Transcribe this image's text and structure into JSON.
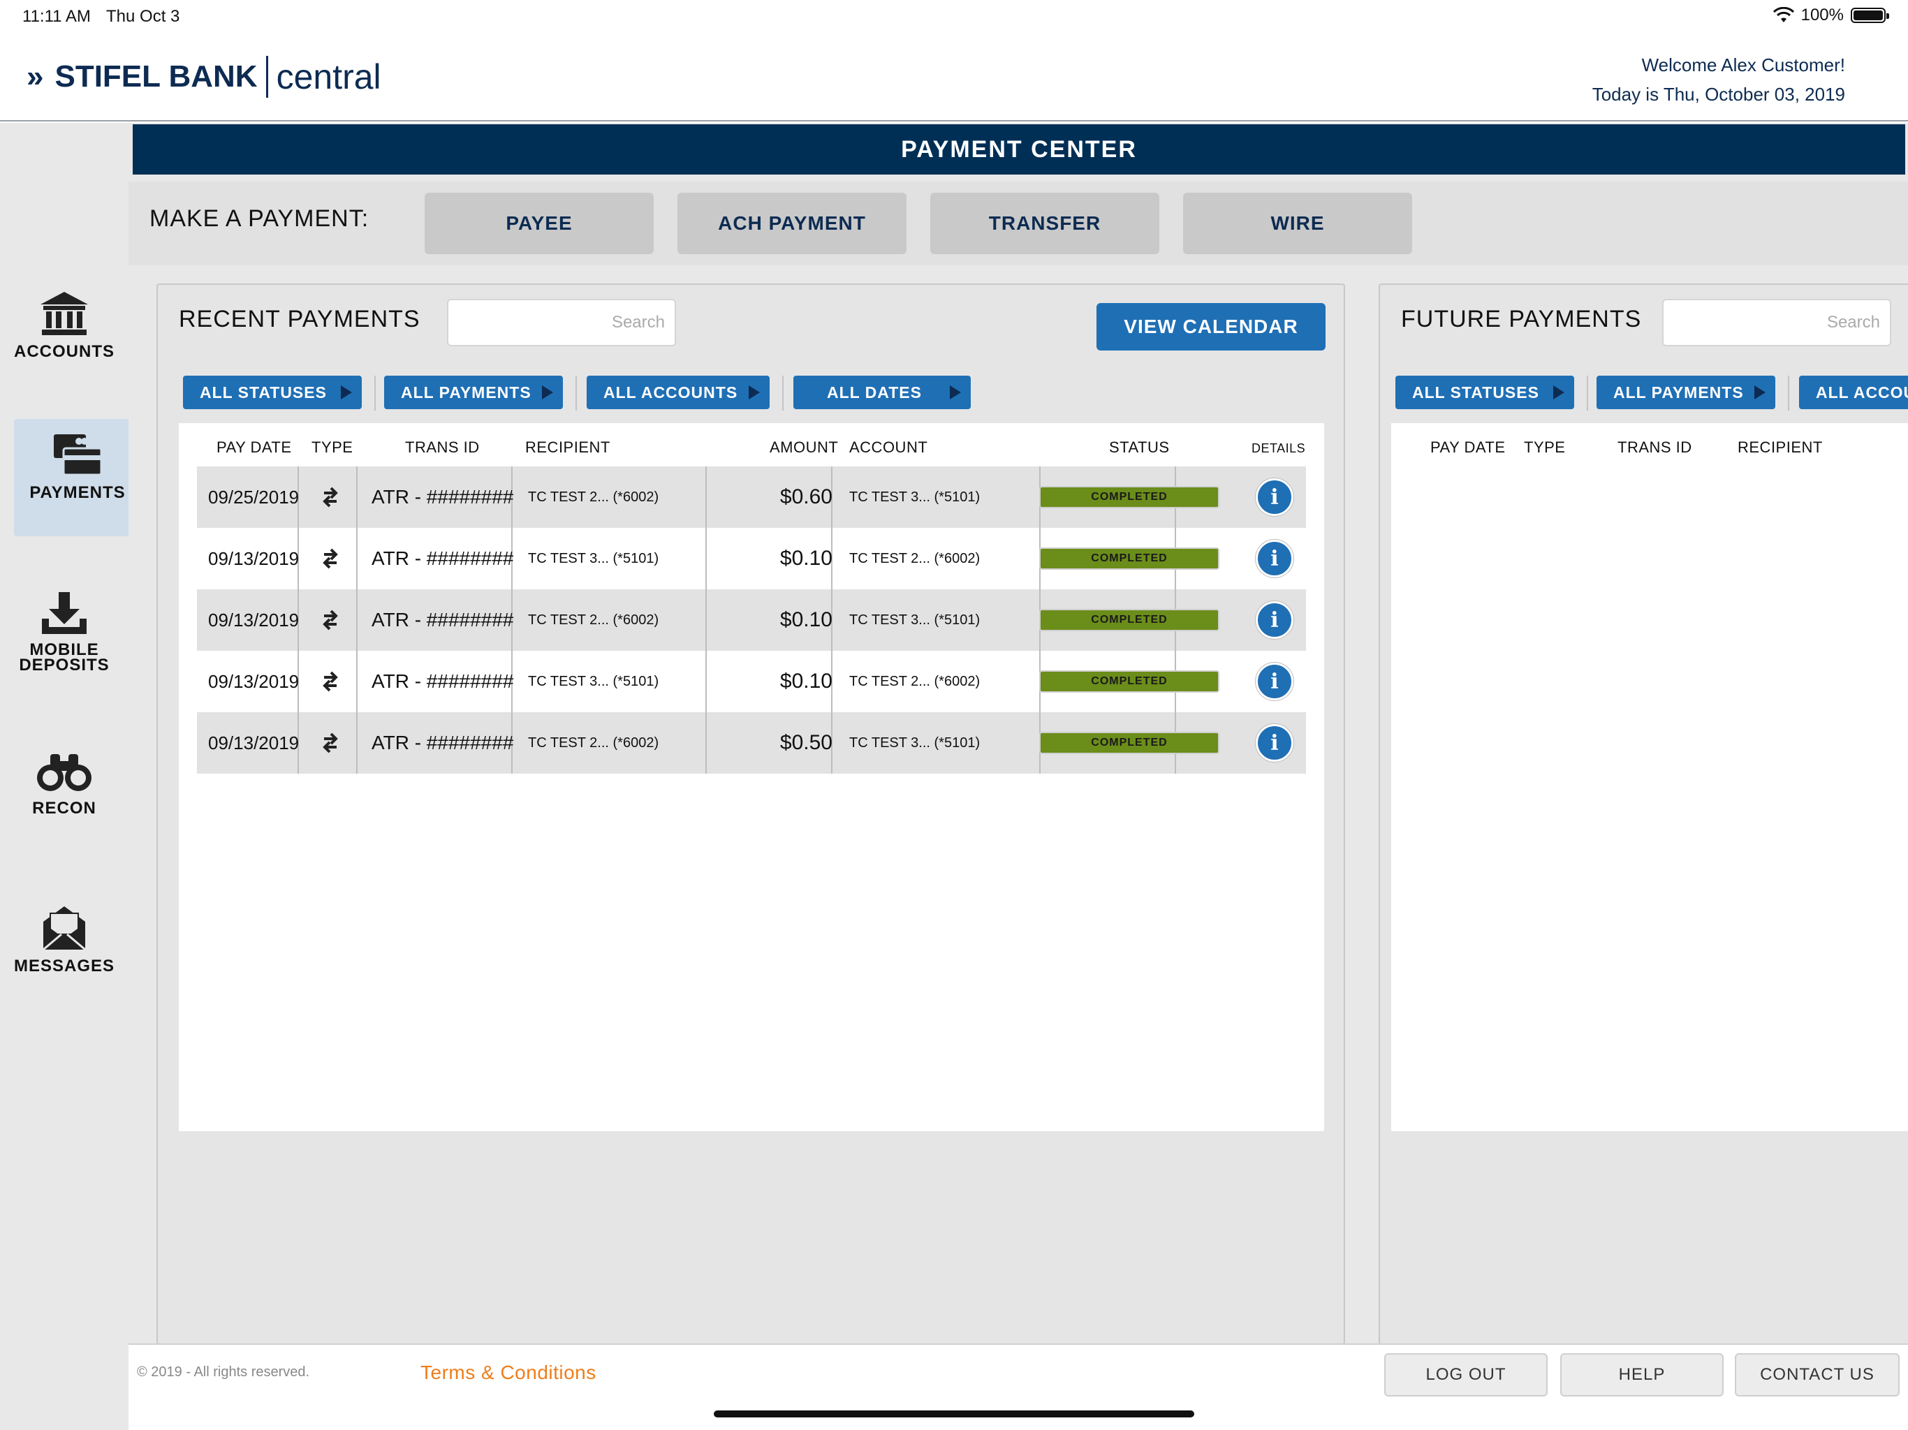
{
  "status_bar": {
    "time": "11:11 AM",
    "date": "Thu Oct 3",
    "battery": "100%"
  },
  "header": {
    "brand_bank": "STIFEL BANK",
    "brand_central": "central",
    "welcome": "Welcome Alex Customer!",
    "today": "Today is Thu, October 03, 2019"
  },
  "sidebar": {
    "items": [
      {
        "label": "ACCOUNTS",
        "icon": "bank-icon"
      },
      {
        "label": "PAYMENTS",
        "icon": "payments-icon",
        "active": true
      },
      {
        "label_1": "MOBILE",
        "label_2": "DEPOSITS",
        "icon": "download-icon"
      },
      {
        "label": "RECON",
        "icon": "binoculars-icon"
      },
      {
        "label": "MESSAGES",
        "icon": "envelope-icon"
      }
    ]
  },
  "payment_center": {
    "title": "PAYMENT CENTER",
    "make_payment_label": "MAKE A PAYMENT:",
    "buttons": [
      "PAYEE",
      "ACH PAYMENT",
      "TRANSFER",
      "WIRE"
    ]
  },
  "recent": {
    "title": "RECENT PAYMENTS",
    "search_placeholder": "Search",
    "view_calendar": "VIEW CALENDAR",
    "filters": [
      "ALL STATUSES",
      "ALL PAYMENTS",
      "ALL ACCOUNTS",
      "ALL DATES"
    ],
    "columns": [
      "PAY DATE",
      "TYPE",
      "TRANS ID",
      "RECIPIENT",
      "AMOUNT",
      "ACCOUNT",
      "STATUS",
      "DETAILS"
    ],
    "rows": [
      {
        "date": "09/25/2019",
        "trans_id": "ATR - ########",
        "recipient": "TC TEST 2... (*6002)",
        "amount": "$0.60",
        "account": "TC TEST 3... (*5101)",
        "status": "COMPLETED"
      },
      {
        "date": "09/13/2019",
        "trans_id": "ATR - ########",
        "recipient": "TC TEST 3... (*5101)",
        "amount": "$0.10",
        "account": "TC TEST 2... (*6002)",
        "status": "COMPLETED"
      },
      {
        "date": "09/13/2019",
        "trans_id": "ATR - ########",
        "recipient": "TC TEST 2... (*6002)",
        "amount": "$0.10",
        "account": "TC TEST 3... (*5101)",
        "status": "COMPLETED"
      },
      {
        "date": "09/13/2019",
        "trans_id": "ATR - ########",
        "recipient": "TC TEST 3... (*5101)",
        "amount": "$0.10",
        "account": "TC TEST 2... (*6002)",
        "status": "COMPLETED"
      },
      {
        "date": "09/13/2019",
        "trans_id": "ATR - ########",
        "recipient": "TC TEST 2... (*6002)",
        "amount": "$0.50",
        "account": "TC TEST 3... (*5101)",
        "status": "COMPLETED"
      }
    ]
  },
  "future": {
    "title": "FUTURE PAYMENTS",
    "search_placeholder": "Search",
    "filters": [
      "ALL STATUSES",
      "ALL PAYMENTS",
      "ALL ACCOU"
    ],
    "columns": [
      "PAY DATE",
      "TYPE",
      "TRANS ID",
      "RECIPIENT"
    ]
  },
  "footer": {
    "copyright": "© 2019 - All rights reserved.",
    "terms": "Terms & Conditions",
    "buttons": [
      "LOG OUT",
      "HELP",
      "CONTACT US"
    ]
  },
  "colors": {
    "navy": "#002f55",
    "accent_blue": "#1f6fb5",
    "completed_green": "#6b8d1a",
    "terms_orange": "#ef7d1a"
  }
}
